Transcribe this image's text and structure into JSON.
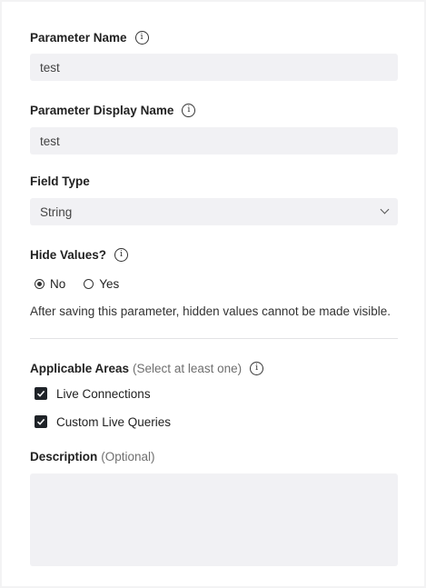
{
  "parameter_name": {
    "label": "Parameter Name",
    "value": "test"
  },
  "parameter_display_name": {
    "label": "Parameter Display Name",
    "value": "test"
  },
  "field_type": {
    "label": "Field Type",
    "selected": "String"
  },
  "hide_values": {
    "label": "Hide Values?",
    "options": [
      {
        "label": "No",
        "selected": true
      },
      {
        "label": "Yes",
        "selected": false
      }
    ],
    "note": "After saving this parameter, hidden values cannot be made visible."
  },
  "applicable_areas": {
    "label": "Applicable Areas",
    "hint": "(Select at least one)",
    "options": [
      {
        "label": "Live Connections",
        "checked": true
      },
      {
        "label": "Custom Live Queries",
        "checked": true
      }
    ]
  },
  "description": {
    "label": "Description",
    "hint": "(Optional)",
    "value": ""
  },
  "icons": {
    "info": "info-circle-icon",
    "chevron": "chevron-down-icon",
    "check": "checkmark-icon"
  }
}
